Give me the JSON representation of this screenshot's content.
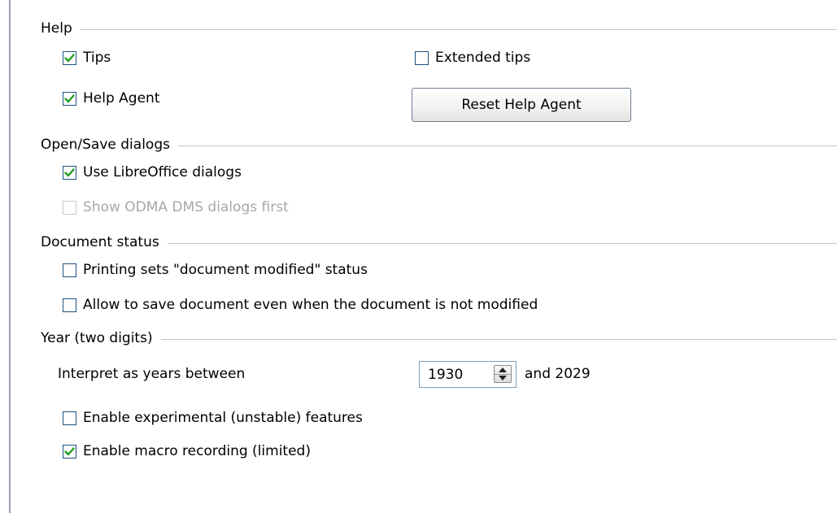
{
  "colors": {
    "accent": "#1c5180",
    "check_mark": "#1f9e1f",
    "disabled_text": "#a8a8a8"
  },
  "sections": {
    "help": "Help",
    "open_save": "Open/Save dialogs",
    "document_status": "Document status",
    "year": "Year (two digits)"
  },
  "help": {
    "tips": {
      "label": "Tips",
      "checked": true
    },
    "extended_tips": {
      "label": "Extended tips",
      "checked": false
    },
    "help_agent": {
      "label": "Help Agent",
      "checked": true
    },
    "reset_button": "Reset Help Agent"
  },
  "open_save": {
    "use_dialogs": {
      "label": "Use LibreOffice dialogs",
      "checked": true
    },
    "show_odma": {
      "label": "Show ODMA DMS dialogs first",
      "checked": false,
      "disabled": true
    }
  },
  "document_status": {
    "printing_sets": {
      "label": "Printing sets \"document modified\" status",
      "checked": false
    },
    "allow_save": {
      "label": "Allow to save document even when the document is not modified",
      "checked": false
    }
  },
  "year": {
    "interpret_label": "Interpret as years between",
    "start_year": "1930",
    "and_label": "and 2029",
    "spinner_icon": "up-down-arrows-icon"
  },
  "misc": {
    "experimental": {
      "label": "Enable experimental (unstable) features",
      "checked": false
    },
    "macro_recording": {
      "label": "Enable macro recording (limited)",
      "checked": true
    }
  }
}
